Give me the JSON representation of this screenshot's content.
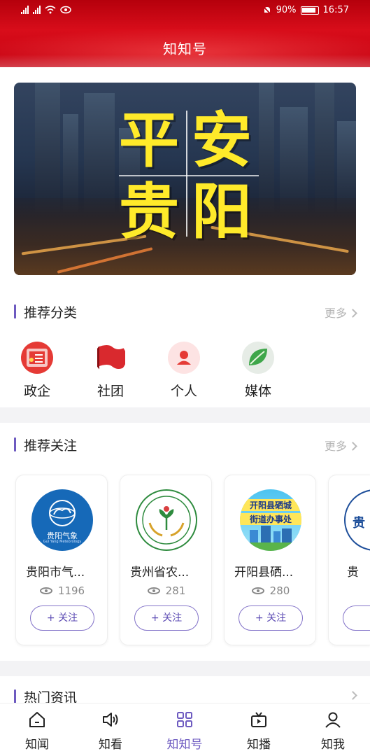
{
  "status_bar": {
    "battery": "90%",
    "time": "16:57"
  },
  "header": {
    "title": "知知号"
  },
  "banner": {
    "line1_a": "平",
    "line1_b": "安",
    "line2_a": "贵",
    "line2_b": "阳"
  },
  "recommended_categories": {
    "title": "推荐分类",
    "more": "更多",
    "items": [
      {
        "label": "政企",
        "icon": "government-icon"
      },
      {
        "label": "社团",
        "icon": "flag-icon"
      },
      {
        "label": "个人",
        "icon": "person-icon"
      },
      {
        "label": "媒体",
        "icon": "leaf-icon"
      }
    ]
  },
  "recommended_follows": {
    "title": "推荐关注",
    "more": "更多",
    "follow_label": "+ 关注",
    "items": [
      {
        "name": "贵阳市气...",
        "views": "1196",
        "logo_text": "贵阳气象",
        "logo_subtext": "Gui Yang Meteorology"
      },
      {
        "name": "贵州省农...",
        "views": "281"
      },
      {
        "name": "开阳县硒...",
        "views": "280",
        "logo_line1": "开阳县硒城",
        "logo_line2": "街道办事处"
      },
      {
        "name": "贵"
      }
    ]
  },
  "hot_news": {
    "title": "热门资讯"
  },
  "tabbar": {
    "tabs": [
      {
        "label": "知闻",
        "icon": "home-icon"
      },
      {
        "label": "知看",
        "icon": "speaker-icon"
      },
      {
        "label": "知知号",
        "icon": "grid-icon",
        "active": true
      },
      {
        "label": "知播",
        "icon": "video-icon"
      },
      {
        "label": "知我",
        "icon": "user-icon"
      }
    ]
  },
  "colors": {
    "header_red": "#c40010",
    "accent_purple": "#6d5ac0",
    "banner_yellow": "#ffea2a"
  }
}
